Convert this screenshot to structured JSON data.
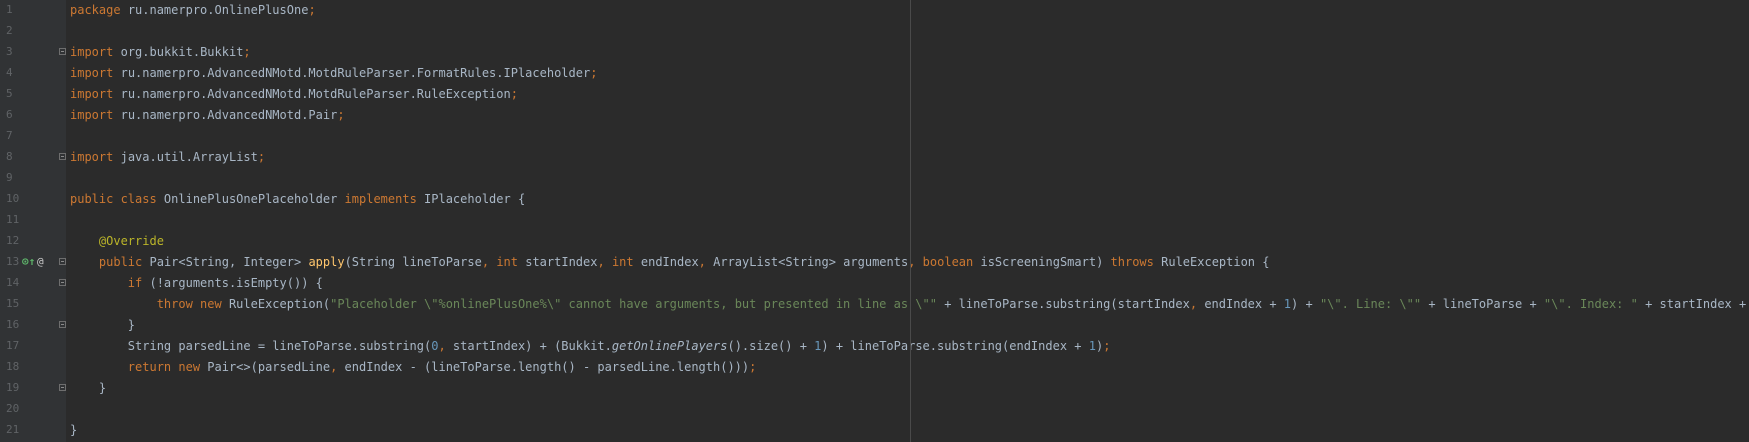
{
  "editor": {
    "line_numbers": [
      "1",
      "2",
      "3",
      "4",
      "5",
      "6",
      "7",
      "8",
      "9",
      "10",
      "11",
      "12",
      "13",
      "14",
      "15",
      "16",
      "17",
      "18",
      "19",
      "20",
      "21"
    ],
    "fold_markers": [
      3,
      8,
      13,
      14,
      16,
      19
    ],
    "gutter_icons": [
      {
        "line": 13,
        "name": "override-icon",
        "glyph": "⊙↑"
      },
      {
        "line": 13,
        "name": "annotation-icon",
        "glyph": "@"
      }
    ],
    "lines": [
      [
        {
          "t": "package",
          "k": "keyword"
        },
        {
          "t": " ",
          "k": "plain"
        },
        {
          "t": "ru.namerpro.OnlinePlusOne",
          "k": "plain"
        },
        {
          "t": ";",
          "k": "punct"
        }
      ],
      [],
      [
        {
          "t": "import",
          "k": "keyword"
        },
        {
          "t": " ",
          "k": "plain"
        },
        {
          "t": "org.bukkit.Bukkit",
          "k": "plain"
        },
        {
          "t": ";",
          "k": "punct"
        }
      ],
      [
        {
          "t": "import",
          "k": "keyword"
        },
        {
          "t": " ",
          "k": "plain"
        },
        {
          "t": "ru.namerpro.AdvancedNMotd.MotdRuleParser.FormatRules.IPlaceholder",
          "k": "plain"
        },
        {
          "t": ";",
          "k": "punct"
        }
      ],
      [
        {
          "t": "import",
          "k": "keyword"
        },
        {
          "t": " ",
          "k": "plain"
        },
        {
          "t": "ru.namerpro.AdvancedNMotd.MotdRuleParser.RuleException",
          "k": "plain"
        },
        {
          "t": ";",
          "k": "punct"
        }
      ],
      [
        {
          "t": "import",
          "k": "keyword"
        },
        {
          "t": " ",
          "k": "plain"
        },
        {
          "t": "ru.namerpro.AdvancedNMotd.Pair",
          "k": "plain"
        },
        {
          "t": ";",
          "k": "punct"
        }
      ],
      [],
      [
        {
          "t": "import",
          "k": "keyword"
        },
        {
          "t": " ",
          "k": "plain"
        },
        {
          "t": "java.util.ArrayList",
          "k": "plain"
        },
        {
          "t": ";",
          "k": "punct"
        }
      ],
      [],
      [
        {
          "t": "public class",
          "k": "keyword"
        },
        {
          "t": " OnlinePlusOnePlaceholder ",
          "k": "plain"
        },
        {
          "t": "implements",
          "k": "keyword"
        },
        {
          "t": " IPlaceholder {",
          "k": "plain"
        }
      ],
      [],
      [
        {
          "t": "    ",
          "k": "plain"
        },
        {
          "t": "@Override",
          "k": "annotation"
        }
      ],
      [
        {
          "t": "    ",
          "k": "plain"
        },
        {
          "t": "public",
          "k": "keyword"
        },
        {
          "t": " Pair<String, Integer> ",
          "k": "plain"
        },
        {
          "t": "apply",
          "k": "function"
        },
        {
          "t": "(String lineToParse",
          "k": "plain"
        },
        {
          "t": ",",
          "k": "punct"
        },
        {
          "t": " ",
          "k": "plain"
        },
        {
          "t": "int",
          "k": "keyword"
        },
        {
          "t": " startIndex",
          "k": "plain"
        },
        {
          "t": ",",
          "k": "punct"
        },
        {
          "t": " ",
          "k": "plain"
        },
        {
          "t": "int",
          "k": "keyword"
        },
        {
          "t": " endIndex",
          "k": "plain"
        },
        {
          "t": ",",
          "k": "punct"
        },
        {
          "t": " ArrayList<String> arguments",
          "k": "plain"
        },
        {
          "t": ",",
          "k": "punct"
        },
        {
          "t": " ",
          "k": "plain"
        },
        {
          "t": "boolean",
          "k": "keyword"
        },
        {
          "t": " isScreeningSmart) ",
          "k": "plain"
        },
        {
          "t": "throws",
          "k": "keyword"
        },
        {
          "t": " RuleException {",
          "k": "plain"
        }
      ],
      [
        {
          "t": "        ",
          "k": "plain"
        },
        {
          "t": "if",
          "k": "keyword"
        },
        {
          "t": " (!arguments.isEmpty()) {",
          "k": "plain"
        }
      ],
      [
        {
          "t": "            ",
          "k": "plain"
        },
        {
          "t": "throw new",
          "k": "keyword"
        },
        {
          "t": " RuleException(",
          "k": "plain"
        },
        {
          "t": "\"Placeholder \\\"%onlinePlusOne%\\\" cannot have arguments, but presented in line as \\\"\"",
          "k": "string"
        },
        {
          "t": " + lineToParse.substring(startIndex",
          "k": "plain"
        },
        {
          "t": ",",
          "k": "punct"
        },
        {
          "t": " endIndex + ",
          "k": "plain"
        },
        {
          "t": "1",
          "k": "number"
        },
        {
          "t": ") + ",
          "k": "plain"
        },
        {
          "t": "\"\\\". Line: \\\"\"",
          "k": "string"
        },
        {
          "t": " + lineToParse + ",
          "k": "plain"
        },
        {
          "t": "\"\\\". Index: \"",
          "k": "string"
        },
        {
          "t": " + startIndex + ",
          "k": "plain"
        },
        {
          "t": "\".\"",
          "k": "string"
        },
        {
          "t": ")",
          "k": "plain"
        },
        {
          "t": ";",
          "k": "punct"
        }
      ],
      [
        {
          "t": "        }",
          "k": "plain"
        }
      ],
      [
        {
          "t": "        String parsedLine = lineToParse.substring(",
          "k": "plain"
        },
        {
          "t": "0",
          "k": "number"
        },
        {
          "t": ",",
          "k": "punct"
        },
        {
          "t": " startIndex) + (Bukkit.",
          "k": "plain"
        },
        {
          "t": "getOnlinePlayers",
          "k": "italic"
        },
        {
          "t": "().size() + ",
          "k": "plain"
        },
        {
          "t": "1",
          "k": "number"
        },
        {
          "t": ") + lineToParse.substring(endIndex + ",
          "k": "plain"
        },
        {
          "t": "1",
          "k": "number"
        },
        {
          "t": ")",
          "k": "plain"
        },
        {
          "t": ";",
          "k": "punct"
        }
      ],
      [
        {
          "t": "        ",
          "k": "plain"
        },
        {
          "t": "return new",
          "k": "keyword"
        },
        {
          "t": " Pair<>(parsedLine",
          "k": "plain"
        },
        {
          "t": ",",
          "k": "punct"
        },
        {
          "t": " endIndex - (lineToParse.length() - parsedLine.length()))",
          "k": "plain"
        },
        {
          "t": ";",
          "k": "punct"
        }
      ],
      [
        {
          "t": "    }",
          "k": "plain"
        }
      ],
      [],
      [
        {
          "t": "}",
          "k": "plain"
        }
      ]
    ]
  }
}
